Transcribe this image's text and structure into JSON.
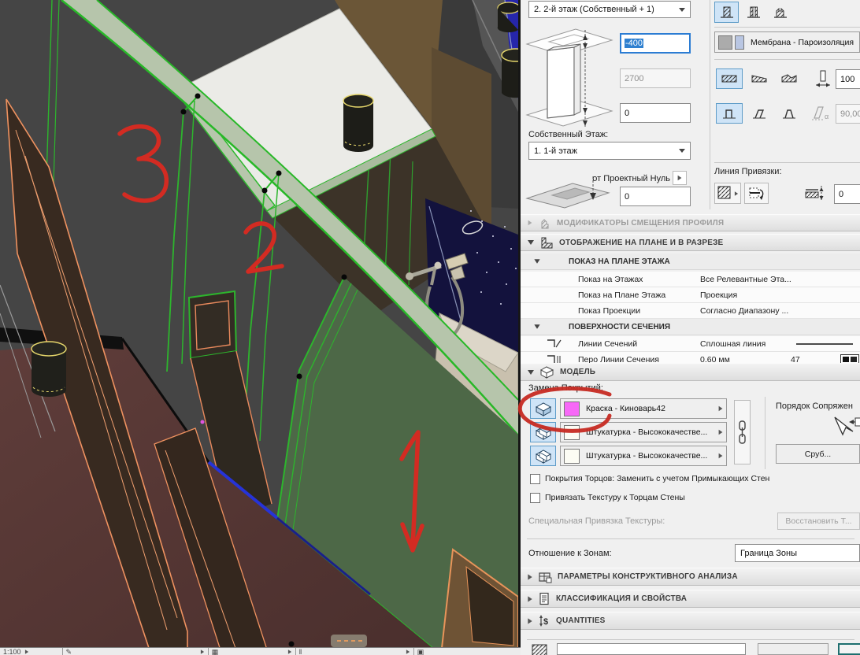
{
  "viewport": {
    "annotations": {
      "first": "1",
      "second": "2",
      "third": "3"
    },
    "statusbar": {
      "scale": "1:100"
    }
  },
  "panel": {
    "story_select": {
      "value": "2. 2-й этаж (Собственный + 1)"
    },
    "elevation": {
      "top_offset": "-400",
      "height": "2700",
      "bottom_offset": "0"
    },
    "home_story": {
      "label": "Собственный Этаж:",
      "value": "1. 1-й этаж"
    },
    "project_zero": {
      "label": "от Проектный Нуль",
      "value": "0"
    },
    "composite": {
      "value": "Мембрана - Пароизоляция"
    },
    "width_field": "100",
    "angle_field": "90,00",
    "reference_line": {
      "label": "Линия Привязки:",
      "offset": "0"
    },
    "sections": {
      "modifiers": "МОДИФИКАТОРЫ СМЕЩЕНИЯ ПРОФИЛЯ",
      "plan_section": "ОТОБРАЖЕНИЕ НА ПЛАНЕ И В РАЗРЕЗЕ",
      "floor_plan_display": "ПОКАЗ НА ПЛАНЕ ЭТАЖА",
      "cut_surfaces": "ПОВЕРХНОСТИ СЕЧЕНИЯ",
      "model": "МОДЕЛЬ",
      "structural": "ПАРАМЕТРЫ КОНСТРУКТИВНОГО АНАЛИЗА",
      "classification": "КЛАССИФИКАЦИЯ И СВОЙСТВА",
      "quantities": "QUANTITIES"
    },
    "display_rows": [
      {
        "label": "Показ на Этажах",
        "value": "Все Релевантные Эта..."
      },
      {
        "label": "Показ на Плане Этажа",
        "value": "Проекция"
      },
      {
        "label": "Показ Проекции",
        "value": "Согласно Диапазону ..."
      }
    ],
    "cut_rows": {
      "lines": {
        "label": "Линии Сечений",
        "value": "Сплошная линия"
      },
      "pen": {
        "label": "Перо Линии Сечения",
        "value": "0.60 мм",
        "pen_number": "47"
      }
    },
    "model_section": {
      "override_label": "Замена Покрытий:",
      "overrides": [
        {
          "name": "Краска - Киноварь42",
          "swatch": "#f768f7"
        },
        {
          "name": "Штукатурка - Высококачестве...",
          "swatch": "#fcfcf4"
        },
        {
          "name": "Штукатурка - Высококачестве...",
          "swatch": "#fcfcf4"
        }
      ],
      "junction_label": "Порядок Сопряжен",
      "log_button": "Сруб...",
      "checkbox_end_faces": "Покрытия Торцов: Заменить с учетом Примыкающих Стен",
      "checkbox_texture": "Привязать Текстуру к Торцам Стены",
      "custom_texture_label": "Специальная Привязка Текстуры:",
      "reset_texture_button": "Восстановить Т..."
    },
    "zones": {
      "label": "Отношение к Зонам:",
      "value": "Граница Зоны"
    }
  },
  "colors": {
    "selection_green": "#2db52d",
    "annotation_red": "#d32b22",
    "override_swatch_magenta": "#f768f7",
    "focused_field_blue": "#2b7cd3"
  }
}
